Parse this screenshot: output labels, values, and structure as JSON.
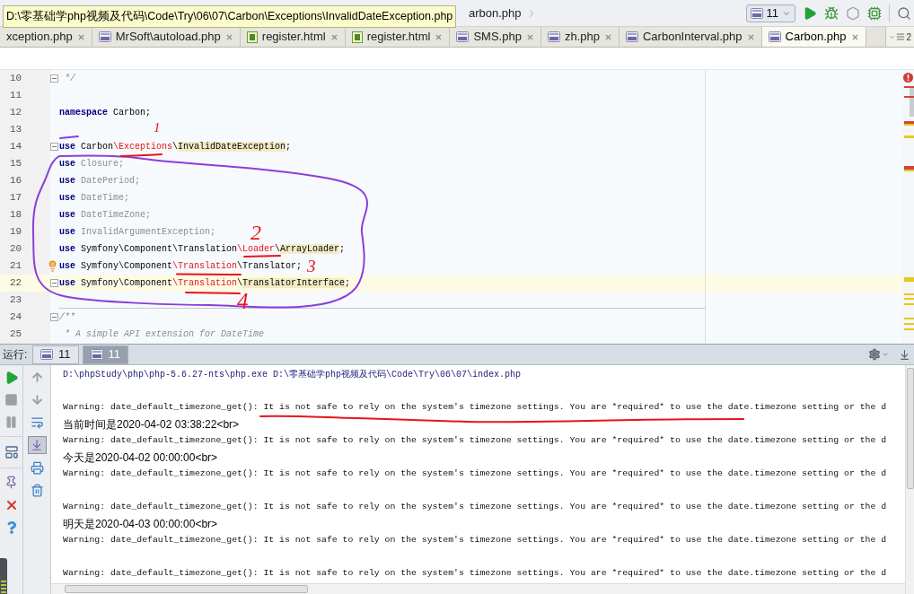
{
  "tooltip": {
    "text": "D:\\零基础学php视频及代码\\Code\\Try\\06\\07\\Carbon\\Exceptions\\InvalidDateException.php"
  },
  "toolbar": {
    "breadcrumb": "arbon.php",
    "run_config": "11"
  },
  "tabs": [
    {
      "label": "xception.php",
      "selected": false
    },
    {
      "label": "MrSoft\\autoload.php",
      "kind": "php",
      "selected": false
    },
    {
      "label": "register.html",
      "kind": "html",
      "selected": false
    },
    {
      "label": "register.html",
      "kind": "html",
      "selected": false
    },
    {
      "label": "SMS.php",
      "kind": "php",
      "selected": false
    },
    {
      "label": "zh.php",
      "kind": "php",
      "selected": false
    },
    {
      "label": "CarbonInterval.php",
      "kind": "php",
      "selected": false
    },
    {
      "label": "Carbon.php",
      "kind": "php",
      "selected": true
    }
  ],
  "tab_overflow": {
    "count": "2"
  },
  "editor": {
    "lines": [
      {
        "number": "10",
        "fold": true,
        "current": false,
        "bulb": false,
        "separator": false,
        "tokens": [
          {
            "kind": "comment",
            "text": " */"
          }
        ]
      },
      {
        "number": "11",
        "fold": false,
        "current": false,
        "bulb": false,
        "separator": false
      },
      {
        "number": "12",
        "fold": false,
        "current": false,
        "bulb": false,
        "separator": false,
        "tokens": [
          {
            "kind": "keyword",
            "text": "namespace"
          },
          {
            "kind": "plain",
            "text": " Carbon;"
          }
        ]
      },
      {
        "number": "13",
        "fold": false,
        "current": false,
        "bulb": false,
        "separator": false
      },
      {
        "number": "14",
        "fold": true,
        "current": false,
        "bulb": false,
        "separator": false,
        "tokens": [
          {
            "kind": "keyword",
            "text": "use"
          },
          {
            "kind": "plain",
            "text": " Carbon"
          },
          {
            "kind": "error",
            "text": "\\Exceptions"
          },
          {
            "kind": "plain",
            "text": "\\"
          },
          {
            "kind": "highlight",
            "text": "InvalidDateException"
          },
          {
            "kind": "plain",
            "text": ";"
          }
        ]
      },
      {
        "number": "15",
        "fold": false,
        "current": false,
        "bulb": false,
        "separator": false,
        "tokens": [
          {
            "kind": "keyword",
            "text": "use"
          },
          {
            "kind": "unused",
            "text": " Closure;"
          }
        ]
      },
      {
        "number": "16",
        "fold": false,
        "current": false,
        "bulb": false,
        "separator": false,
        "tokens": [
          {
            "kind": "keyword",
            "text": "use"
          },
          {
            "kind": "unused",
            "text": " DatePeriod;"
          }
        ]
      },
      {
        "number": "17",
        "fold": false,
        "current": false,
        "bulb": false,
        "separator": false,
        "tokens": [
          {
            "kind": "keyword",
            "text": "use"
          },
          {
            "kind": "unused",
            "text": " DateTime;"
          }
        ]
      },
      {
        "number": "18",
        "fold": false,
        "current": false,
        "bulb": false,
        "separator": false,
        "tokens": [
          {
            "kind": "keyword",
            "text": "use"
          },
          {
            "kind": "unused",
            "text": " DateTimeZone;"
          }
        ]
      },
      {
        "number": "19",
        "fold": false,
        "current": false,
        "bulb": false,
        "separator": false,
        "tokens": [
          {
            "kind": "keyword",
            "text": "use"
          },
          {
            "kind": "unused",
            "text": " InvalidArgumentException;"
          }
        ]
      },
      {
        "number": "20",
        "fold": false,
        "current": false,
        "bulb": false,
        "separator": false,
        "tokens": [
          {
            "kind": "keyword",
            "text": "use"
          },
          {
            "kind": "plain",
            "text": " Symfony\\Component\\Translation"
          },
          {
            "kind": "error",
            "text": "\\Loader"
          },
          {
            "kind": "plain",
            "text": "\\"
          },
          {
            "kind": "highlight",
            "text": "ArrayLoader"
          },
          {
            "kind": "plain",
            "text": ";"
          }
        ]
      },
      {
        "number": "21",
        "fold": false,
        "current": false,
        "bulb": true,
        "separator": false,
        "tokens": [
          {
            "kind": "keyword",
            "text": "use"
          },
          {
            "kind": "plain",
            "text": " Symfony\\Component"
          },
          {
            "kind": "error",
            "text": "\\Translation"
          },
          {
            "kind": "plain",
            "text": "\\Translator;"
          }
        ]
      },
      {
        "number": "22",
        "fold": true,
        "current": true,
        "bulb": false,
        "separator": false,
        "tokens": [
          {
            "kind": "keyword",
            "text": "use"
          },
          {
            "kind": "plain",
            "text": " Symfony\\Component"
          },
          {
            "kind": "error",
            "text": "\\Translation"
          },
          {
            "kind": "plain",
            "text": "\\"
          },
          {
            "kind": "highlight",
            "text": "TranslatorInterface"
          },
          {
            "kind": "plain",
            "text": ";"
          }
        ]
      },
      {
        "number": "23",
        "fold": false,
        "current": false,
        "bulb": false,
        "separator": true
      },
      {
        "number": "24",
        "fold": true,
        "current": false,
        "bulb": false,
        "separator": false,
        "tokens": [
          {
            "kind": "comment",
            "text": "/**"
          }
        ]
      },
      {
        "number": "25",
        "fold": false,
        "current": false,
        "bulb": false,
        "separator": false,
        "tokens": [
          {
            "kind": "comment",
            "text": " * A simple API extension for DateTime"
          }
        ]
      }
    ],
    "error_stripe": {
      "has_errors": true,
      "marks": [
        {
          "kind": "error"
        },
        {
          "kind": "error"
        },
        {
          "kind": "error"
        },
        {
          "kind": "warning"
        },
        {
          "kind": "warning"
        },
        {
          "kind": "error"
        },
        {
          "kind": "warning"
        },
        {
          "kind": "warning"
        },
        {
          "kind": "warning"
        },
        {
          "kind": "warning"
        },
        {
          "kind": "warning"
        },
        {
          "kind": "warning"
        },
        {
          "kind": "warning"
        },
        {
          "kind": "warning"
        }
      ]
    }
  },
  "annotations": {
    "labels": [
      {
        "text": "1"
      },
      {
        "text": "2"
      },
      {
        "text": "3"
      },
      {
        "text": "4"
      }
    ]
  },
  "run_panel": {
    "label": "运行:",
    "tabs": [
      {
        "label": "11",
        "selected": false
      },
      {
        "label": "11",
        "selected": true
      }
    ],
    "toolbar": {
      "soft_wrap": false,
      "scroll_to_end": true
    },
    "output": [
      {
        "kind": "command",
        "text": "D:\\phpStudy\\php\\php-5.6.27-nts\\php.exe D:\\零基础学php视频及代码\\Code\\Try\\06\\07\\index.php"
      },
      {
        "kind": "blank"
      },
      {
        "kind": "warning",
        "text": "Warning: date_default_timezone_get(): It is not safe to rely on the system's timezone settings. You are *required* to use the date.timezone setting or the d"
      },
      {
        "kind": "result",
        "text": "当前时间是2020-04-02 03:38:22<br>"
      },
      {
        "kind": "warning",
        "text": "Warning: date_default_timezone_get(): It is not safe to rely on the system's timezone settings. You are *required* to use the date.timezone setting or the d"
      },
      {
        "kind": "result",
        "text": "今天是2020-04-02 00:00:00<br>"
      },
      {
        "kind": "warning",
        "text": "Warning: date_default_timezone_get(): It is not safe to rely on the system's timezone settings. You are *required* to use the date.timezone setting or the d"
      },
      {
        "kind": "blank"
      },
      {
        "kind": "warning",
        "text": "Warning: date_default_timezone_get(): It is not safe to rely on the system's timezone settings. You are *required* to use the date.timezone setting or the d"
      },
      {
        "kind": "result",
        "text": "明天是2020-04-03 00:00:00<br>"
      },
      {
        "kind": "warning",
        "text": "Warning: date_default_timezone_get(): It is not safe to rely on the system's timezone settings. You are *required* to use the date.timezone setting or the d"
      },
      {
        "kind": "blank"
      },
      {
        "kind": "warning",
        "text": "Warning: date_default_timezone_get(): It is not safe to rely on the system's timezone settings. You are *required* to use the date.timezone setting or the d"
      }
    ]
  }
}
